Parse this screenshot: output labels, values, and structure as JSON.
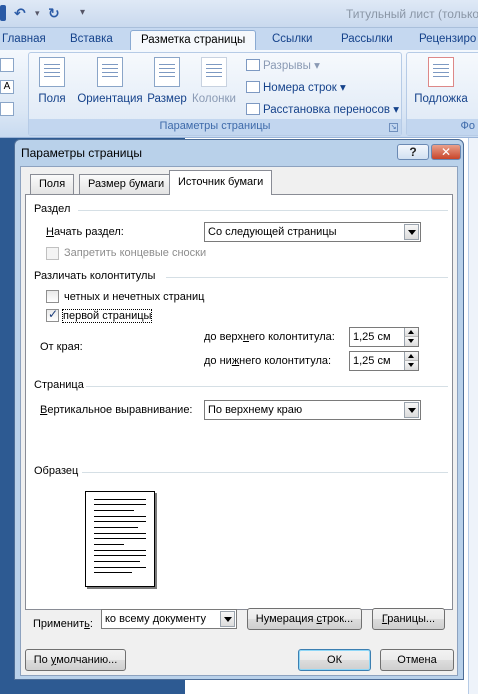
{
  "word": {
    "window_title": "Титульный лист (только",
    "tabs": [
      "Главная",
      "Вставка",
      "Разметка страницы",
      "Ссылки",
      "Рассылки",
      "Рецензиро"
    ],
    "active_tab": "Разметка страницы",
    "ribbon": {
      "page_setup_group": "Параметры страницы",
      "buttons": {
        "margins": "Поля",
        "orientation": "Ориентация",
        "size": "Размер",
        "columns": "Колонки",
        "breaks": "Разрывы",
        "line_numbers": "Номера строк",
        "hyphenation": "Расстановка переносов",
        "watermark": "Подложка"
      },
      "next_group_partial": "Фо"
    }
  },
  "dialog": {
    "title": "Параметры страницы",
    "help_glyph": "?",
    "close_glyph": "✕",
    "tabs": [
      "Поля",
      "Размер бумаги",
      "Источник бумаги"
    ],
    "selected_tab": "Источник бумаги",
    "section": {
      "heading": "Раздел",
      "start_label_accel": "Н",
      "start_label_rest": "ачать раздел:",
      "start_value": "Со следующей страницы",
      "suppress_endnotes": "Запретить концевые сноски"
    },
    "headers_footers": {
      "heading": "Различать колонтитулы",
      "odd_even_label": "четных и нечетных страниц",
      "odd_even_checked": false,
      "first_page_label": "первой страницы",
      "first_page_checked": true,
      "from_edge_label": "От края:",
      "header_label_pre": "до верх",
      "header_label_accel": "н",
      "header_label_post": "его колонтитула:",
      "header_value": "1,25 см",
      "footer_label_pre": "до ни",
      "footer_label_accel": "ж",
      "footer_label_post": "него колонтитула:",
      "footer_value": "1,25 см"
    },
    "page": {
      "heading": "Страница",
      "valign_label_accel": "В",
      "valign_label_rest": "ертикальное выравнивание:",
      "valign_value": "По верхнему краю"
    },
    "preview": {
      "heading": "Образец"
    },
    "apply": {
      "label_pre": "Применит",
      "label_accel": "ь",
      "label_post": ":",
      "value": "ко всему документу"
    },
    "buttons": {
      "line_numbers_pre": "Нумерация ",
      "line_numbers_accel": "с",
      "line_numbers_post": "трок...",
      "borders_accel": "Г",
      "borders_rest": "раницы...",
      "default_pre": "По ",
      "default_accel": "у",
      "default_post": "молчанию...",
      "ok": "ОК",
      "cancel": "Отмена"
    }
  }
}
